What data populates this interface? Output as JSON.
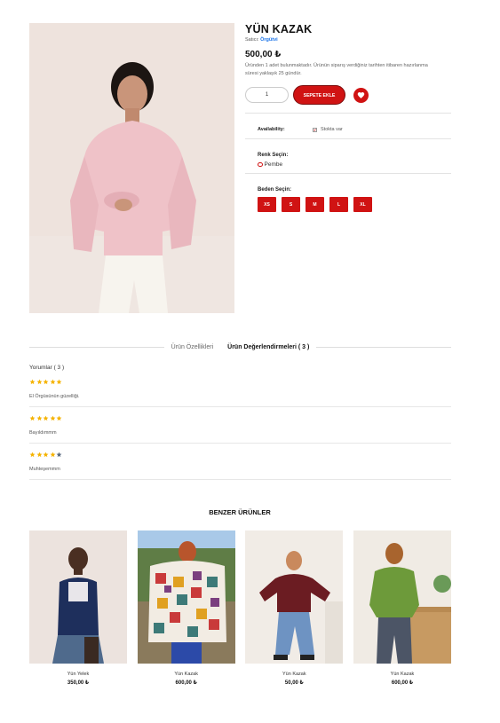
{
  "product": {
    "title": "YÜN KAZAK",
    "seller_label": "Satıcı:",
    "seller_name": "Örgütvi",
    "price": "500,00 ₺",
    "stock_note": "Üründen 1 adet bulunmaktadır. Ürünün siparış verdiğiniz tarihten itibaren hazırlanma süresi yaklaşık 25 gündür.",
    "quantity": "1",
    "add_to_cart_label": "SEPETE EKLE",
    "availability_label": "Availability:",
    "availability_value": "Stokta var",
    "color_label": "Renk Seçin:",
    "color_option": "Pembe",
    "size_label": "Beden Seçin:",
    "sizes": [
      "XS",
      "S",
      "M",
      "L",
      "XL"
    ]
  },
  "tabs": {
    "features": "Ürün Özellikleri",
    "reviews": "Ürün Değerlendirmeleri ( 3 )"
  },
  "reviews": {
    "title": "Yorumlar ( 3 )",
    "items": [
      {
        "rating": 5,
        "text": "El Örgüsünün güzelliği."
      },
      {
        "rating": 5,
        "text": "Bayıldımmm"
      },
      {
        "rating": 4,
        "text": "Muhteşemmm"
      }
    ]
  },
  "similar": {
    "title": "BENZER ÜRÜNLER",
    "items": [
      {
        "name": "Yün Yelek",
        "price": "350,00 ₺"
      },
      {
        "name": "Yün Kazak",
        "price": "600,00 ₺"
      },
      {
        "name": "Yün Kazak",
        "price": "50,00 ₺"
      },
      {
        "name": "Yün Kazak",
        "price": "600,00 ₺"
      }
    ]
  },
  "colors": {
    "accent": "#d01313",
    "star_filled": "#f5b301",
    "star_empty": "#5a6a80",
    "link": "#1a73e8"
  },
  "icons": {
    "favorite": "heart-icon",
    "checkbox": "check-icon",
    "rating": "star-icon"
  }
}
